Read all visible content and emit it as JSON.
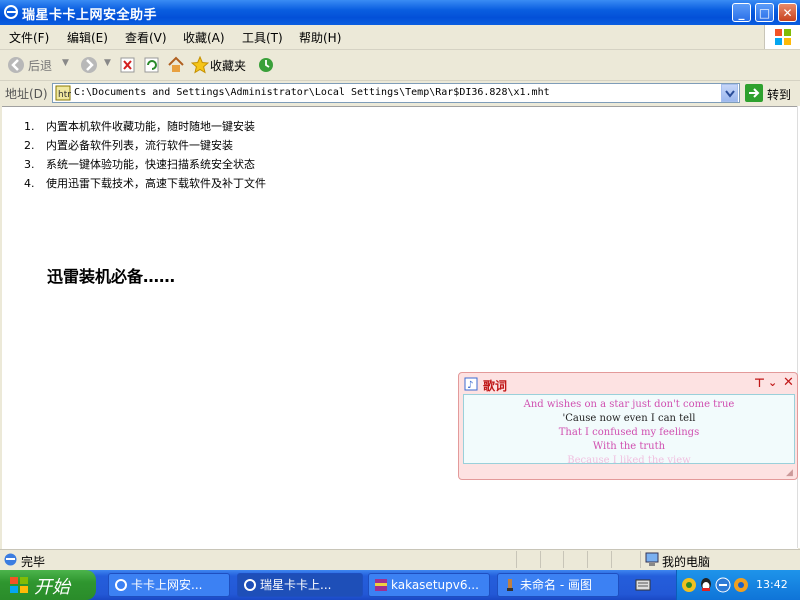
{
  "window": {
    "title": "瑞星卡卡上网安全助手",
    "buttons": {
      "minimize": "_",
      "maximize": "□",
      "close": "✕"
    }
  },
  "menubar": {
    "items": [
      "文件(F)",
      "编辑(E)",
      "查看(V)",
      "收藏(A)",
      "工具(T)",
      "帮助(H)"
    ]
  },
  "toolbar": {
    "back_label": "后退",
    "favorites_label": "收藏夹"
  },
  "address": {
    "label": "地址(D)",
    "value": "C:\\Documents and Settings\\Administrator\\Local Settings\\Temp\\Rar$DI36.828\\x1.mht",
    "go_label": "转到"
  },
  "content": {
    "list": [
      {
        "num": "1.",
        "text": "内置本机软件收藏功能，随时随地一键安装"
      },
      {
        "num": "2.",
        "text": "内置必备软件列表，流行软件一键安装"
      },
      {
        "num": "3.",
        "text": "系统一键体验功能，快速扫描系统安全状态"
      },
      {
        "num": "4.",
        "text": "使用迅雷下载技术，高速下载软件及补丁文件"
      }
    ],
    "heading": "迅雷装机必备……"
  },
  "lyrics": {
    "title": "歌词",
    "lines": [
      "And wishes on a star just don't come true",
      "'Cause now even I can tell",
      "That I confused my feelings",
      "With the truth",
      "Because I liked the view"
    ],
    "colors": {
      "highlight": "#d04fb0",
      "normal": "#222222",
      "fade": "#f0c0e0"
    }
  },
  "statusbar": {
    "status": "完毕",
    "zone": "我的电脑"
  },
  "taskbar": {
    "start_label": "开始",
    "tasks": [
      {
        "label": "卡卡上网安..."
      },
      {
        "label": "瑞星卡卡上..."
      },
      {
        "label": "kakasetupv6..."
      },
      {
        "label": "未命名 - 画图"
      }
    ],
    "clock": "13:42"
  }
}
